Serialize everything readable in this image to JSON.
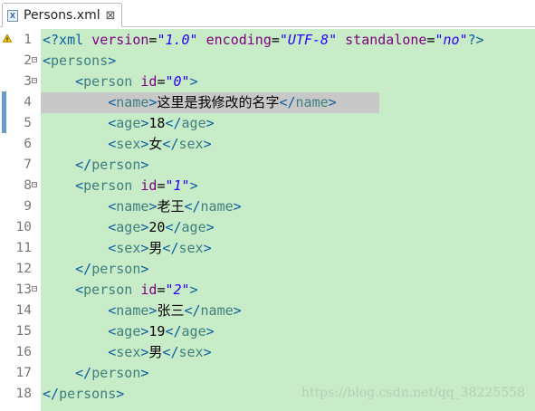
{
  "tab": {
    "title": "Persons.xml",
    "close_glyph": "⊠",
    "icon": "xml-file-icon",
    "icon_glyph": "X"
  },
  "editor": {
    "background": "#c8ebc8",
    "current_line_highlight": "#c8c8c8",
    "current_line": 4,
    "lines": [
      {
        "n": "1",
        "fold": "",
        "tokens": [
          [
            "tb",
            "<?xml "
          ],
          [
            "an",
            "version"
          ],
          [
            "tx",
            "="
          ],
          [
            "av",
            "\"1.0\""
          ],
          [
            "tx",
            " "
          ],
          [
            "an",
            "encoding"
          ],
          [
            "tx",
            "="
          ],
          [
            "av",
            "\"UTF-8\""
          ],
          [
            "tx",
            " "
          ],
          [
            "an",
            "standalone"
          ],
          [
            "tx",
            "="
          ],
          [
            "av",
            "\"no\""
          ],
          [
            "tb",
            "?>"
          ]
        ]
      },
      {
        "n": "2",
        "fold": "⊖",
        "tokens": [
          [
            "tb",
            "<"
          ],
          [
            "tn",
            "persons"
          ],
          [
            "tb",
            ">"
          ]
        ]
      },
      {
        "n": "3",
        "fold": "⊖",
        "tokens": [
          [
            "tx",
            "    "
          ],
          [
            "tb",
            "<"
          ],
          [
            "tn",
            "person"
          ],
          [
            "tx",
            " "
          ],
          [
            "an",
            "id"
          ],
          [
            "tx",
            "="
          ],
          [
            "av",
            "\"0\""
          ],
          [
            "tb",
            ">"
          ]
        ]
      },
      {
        "n": "4",
        "fold": "",
        "tokens": [
          [
            "tx",
            "        "
          ],
          [
            "tb",
            "<"
          ],
          [
            "tn",
            "name"
          ],
          [
            "tb",
            ">"
          ],
          [
            "tx",
            "这里是我修改的名字"
          ],
          [
            "tb",
            "</"
          ],
          [
            "tn",
            "name"
          ],
          [
            "tb",
            ">"
          ]
        ]
      },
      {
        "n": "5",
        "fold": "",
        "tokens": [
          [
            "tx",
            "        "
          ],
          [
            "tb",
            "<"
          ],
          [
            "tn",
            "age"
          ],
          [
            "tb",
            ">"
          ],
          [
            "tx",
            "18"
          ],
          [
            "tb",
            "</"
          ],
          [
            "tn",
            "age"
          ],
          [
            "tb",
            ">"
          ]
        ]
      },
      {
        "n": "6",
        "fold": "",
        "tokens": [
          [
            "tx",
            "        "
          ],
          [
            "tb",
            "<"
          ],
          [
            "tn",
            "sex"
          ],
          [
            "tb",
            ">"
          ],
          [
            "tx",
            "女"
          ],
          [
            "tb",
            "</"
          ],
          [
            "tn",
            "sex"
          ],
          [
            "tb",
            ">"
          ]
        ]
      },
      {
        "n": "7",
        "fold": "",
        "tokens": [
          [
            "tx",
            "    "
          ],
          [
            "tb",
            "</"
          ],
          [
            "tn",
            "person"
          ],
          [
            "tb",
            ">"
          ]
        ]
      },
      {
        "n": "8",
        "fold": "⊖",
        "tokens": [
          [
            "tx",
            "    "
          ],
          [
            "tb",
            "<"
          ],
          [
            "tn",
            "person"
          ],
          [
            "tx",
            " "
          ],
          [
            "an",
            "id"
          ],
          [
            "tx",
            "="
          ],
          [
            "av",
            "\"1\""
          ],
          [
            "tb",
            ">"
          ]
        ]
      },
      {
        "n": "9",
        "fold": "",
        "tokens": [
          [
            "tx",
            "        "
          ],
          [
            "tb",
            "<"
          ],
          [
            "tn",
            "name"
          ],
          [
            "tb",
            ">"
          ],
          [
            "tx",
            "老王"
          ],
          [
            "tb",
            "</"
          ],
          [
            "tn",
            "name"
          ],
          [
            "tb",
            ">"
          ]
        ]
      },
      {
        "n": "10",
        "fold": "",
        "tokens": [
          [
            "tx",
            "        "
          ],
          [
            "tb",
            "<"
          ],
          [
            "tn",
            "age"
          ],
          [
            "tb",
            ">"
          ],
          [
            "tx",
            "20"
          ],
          [
            "tb",
            "</"
          ],
          [
            "tn",
            "age"
          ],
          [
            "tb",
            ">"
          ]
        ]
      },
      {
        "n": "11",
        "fold": "",
        "tokens": [
          [
            "tx",
            "        "
          ],
          [
            "tb",
            "<"
          ],
          [
            "tn",
            "sex"
          ],
          [
            "tb",
            ">"
          ],
          [
            "tx",
            "男"
          ],
          [
            "tb",
            "</"
          ],
          [
            "tn",
            "sex"
          ],
          [
            "tb",
            ">"
          ]
        ]
      },
      {
        "n": "12",
        "fold": "",
        "tokens": [
          [
            "tx",
            "    "
          ],
          [
            "tb",
            "</"
          ],
          [
            "tn",
            "person"
          ],
          [
            "tb",
            ">"
          ]
        ]
      },
      {
        "n": "13",
        "fold": "⊖",
        "tokens": [
          [
            "tx",
            "    "
          ],
          [
            "tb",
            "<"
          ],
          [
            "tn",
            "person"
          ],
          [
            "tx",
            " "
          ],
          [
            "an",
            "id"
          ],
          [
            "tx",
            "="
          ],
          [
            "av",
            "\"2\""
          ],
          [
            "tb",
            ">"
          ]
        ]
      },
      {
        "n": "14",
        "fold": "",
        "tokens": [
          [
            "tx",
            "        "
          ],
          [
            "tb",
            "<"
          ],
          [
            "tn",
            "name"
          ],
          [
            "tb",
            ">"
          ],
          [
            "tx",
            "张三"
          ],
          [
            "tb",
            "</"
          ],
          [
            "tn",
            "name"
          ],
          [
            "tb",
            ">"
          ]
        ]
      },
      {
        "n": "15",
        "fold": "",
        "tokens": [
          [
            "tx",
            "        "
          ],
          [
            "tb",
            "<"
          ],
          [
            "tn",
            "age"
          ],
          [
            "tb",
            ">"
          ],
          [
            "tx",
            "19"
          ],
          [
            "tb",
            "</"
          ],
          [
            "tn",
            "age"
          ],
          [
            "tb",
            ">"
          ]
        ]
      },
      {
        "n": "16",
        "fold": "",
        "tokens": [
          [
            "tx",
            "        "
          ],
          [
            "tb",
            "<"
          ],
          [
            "tn",
            "sex"
          ],
          [
            "tb",
            ">"
          ],
          [
            "tx",
            "男"
          ],
          [
            "tb",
            "</"
          ],
          [
            "tn",
            "sex"
          ],
          [
            "tb",
            ">"
          ]
        ]
      },
      {
        "n": "17",
        "fold": "",
        "tokens": [
          [
            "tx",
            "    "
          ],
          [
            "tb",
            "</"
          ],
          [
            "tn",
            "person"
          ],
          [
            "tb",
            ">"
          ]
        ]
      },
      {
        "n": "18",
        "fold": "",
        "tokens": [
          [
            "tb",
            "</"
          ],
          [
            "tn",
            "persons"
          ],
          [
            "tb",
            ">"
          ]
        ]
      }
    ]
  },
  "watermark": "https://blog.csdn.net/qq_38225558",
  "warning_icon": "warning-icon"
}
